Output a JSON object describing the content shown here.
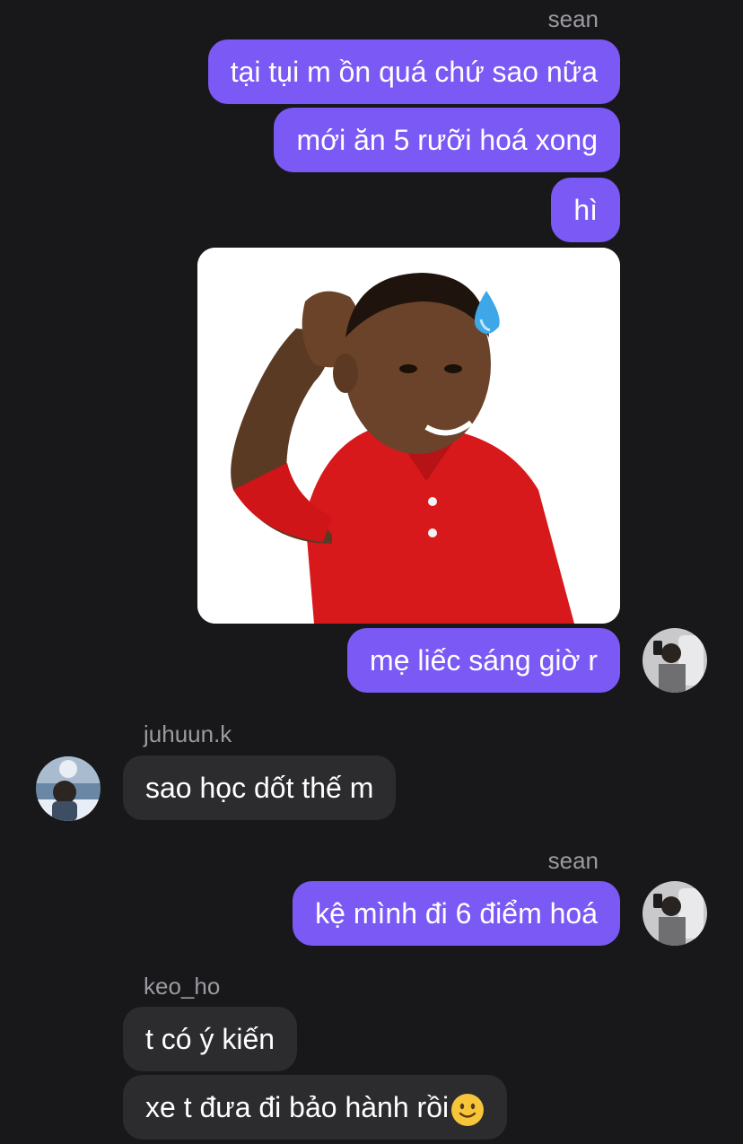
{
  "messages": [
    {
      "sender": "sean",
      "text": "tại tụi m ồn quá chứ sao nữa"
    },
    {
      "text": "mới ăn 5 rưỡi hoá xong"
    },
    {
      "text": "hì"
    },
    {
      "text": "mẹ liếc sáng giờ r"
    },
    {
      "sender": "juhuun.k",
      "text": "sao học dốt thế m"
    },
    {
      "sender": "sean",
      "text": "kệ mình đi 6 điểm hoá"
    },
    {
      "sender": "keo_ho",
      "text": "t có ý kiến"
    },
    {
      "text": "xe t đưa đi bảo hành rồi"
    }
  ],
  "sticker": {
    "icon": "sweat-drop-icon"
  },
  "emoji": {
    "icon": "slightly-smiling-face-icon"
  },
  "colors": {
    "background": "#18181b",
    "outgoing_bubble": "#7b59f5",
    "incoming_bubble": "#2c2c2f",
    "sender_name": "#9a9aa0"
  }
}
